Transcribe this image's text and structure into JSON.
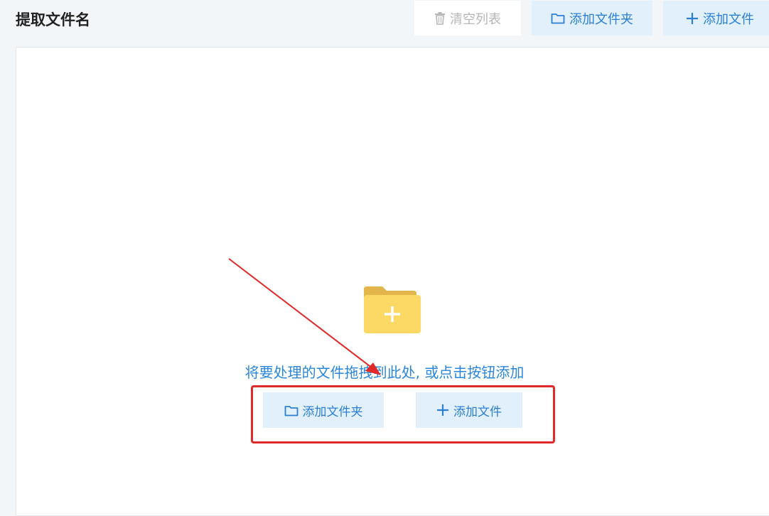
{
  "header": {
    "title": "提取文件名",
    "clear_label": "清空列表",
    "add_folder_label": "添加文件夹",
    "add_file_label": "添加文件"
  },
  "dropzone": {
    "hint": "将要处理的文件拖拽到此处, 或点击按钮添加",
    "add_folder_label": "添加文件夹",
    "add_file_label": "添加文件"
  },
  "colors": {
    "accent": "#2a7fd4",
    "button_bg": "#e2f0fb",
    "folder": "#fcd865",
    "annotation": "#e02a2a"
  },
  "icons": [
    "trash-icon",
    "folder-icon",
    "plus-icon",
    "folder-plus-icon"
  ]
}
